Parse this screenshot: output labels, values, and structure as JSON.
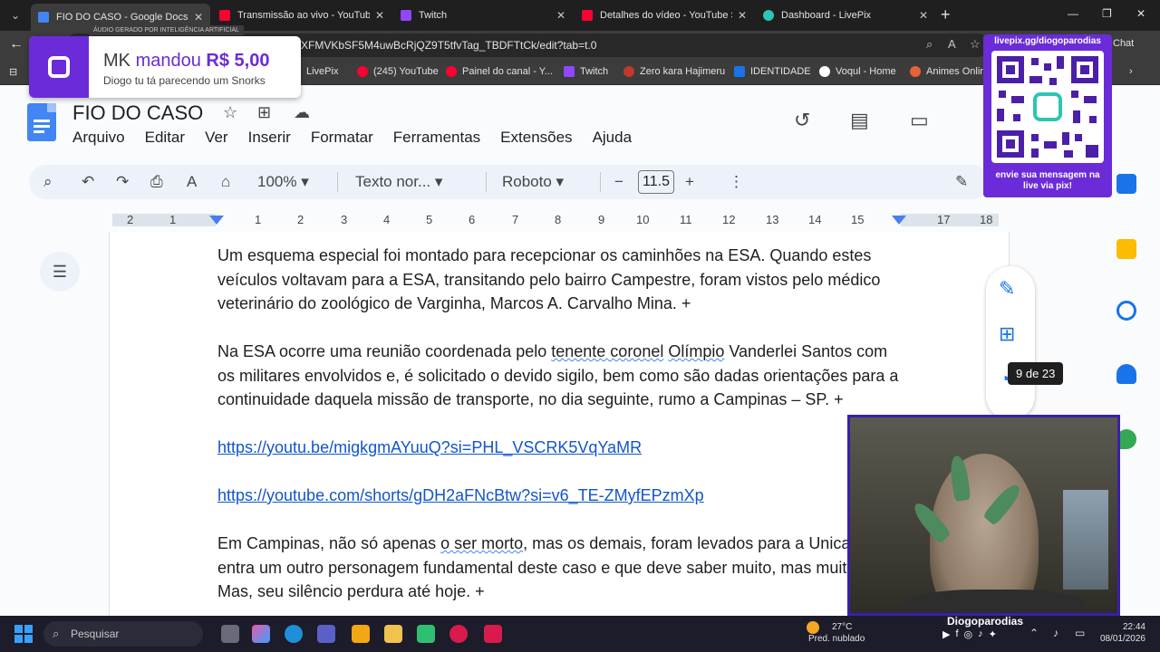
{
  "browser": {
    "tabs": [
      {
        "title": "FIO DO CASO - Google Docs",
        "active": true,
        "favicon_color": "#4285f4"
      },
      {
        "title": "Transmissão ao vivo - YouTube Studio",
        "active": false,
        "favicon_color": "#ff0033"
      },
      {
        "title": "Twitch",
        "active": false,
        "favicon_color": "#9146ff"
      },
      {
        "title": "Detalhes do vídeo - YouTube Studio",
        "active": false,
        "favicon_color": "#ff0033"
      },
      {
        "title": "Dashboard - LivePix",
        "active": false,
        "favicon_color": "#2ec4b6"
      }
    ],
    "url": "XFMVKbSF5M4uwBcRjQZ9T5tfvTag_TBDFTtCk/edit?tab=t.0",
    "chat_label": "Chat",
    "bookmarks": [
      {
        "label": "LivePix",
        "color": "#2ec4b6"
      },
      {
        "label": "(245) YouTube",
        "color": "#ff0033"
      },
      {
        "label": "Painel do canal - Y...",
        "color": "#ff0033"
      },
      {
        "label": "Twitch",
        "color": "#9146ff"
      },
      {
        "label": "Zero kara Hajimeru",
        "color": "#c0392b"
      },
      {
        "label": "IDENTIDADE",
        "color": "#1a73e8"
      },
      {
        "label": "Voqul - Home",
        "color": "#ffffff"
      },
      {
        "label": "Animes Online",
        "color": "#e8613a"
      }
    ]
  },
  "docs": {
    "title": "FIO DO CASO",
    "menus": [
      "Arquivo",
      "Editar",
      "Ver",
      "Inserir",
      "Formatar",
      "Ferramentas",
      "Extensões",
      "Ajuda"
    ],
    "toolbar": {
      "zoom": "100%",
      "style": "Texto nor...",
      "font": "Roboto",
      "font_size": "11.5"
    },
    "ruler_numbers": [
      "2",
      "1",
      "1",
      "2",
      "3",
      "4",
      "5",
      "6",
      "7",
      "8",
      "9",
      "10",
      "11",
      "12",
      "13",
      "14",
      "15",
      "16",
      "17",
      "18"
    ],
    "body": {
      "p1": "Um esquema especial foi montado para recepcionar os caminhões na ESA. Quando estes veículos voltavam para a ESA, transitando pelo bairro Campestre, foram vistos pelo médico veterinário do zoológico de Varginha, Marcos A. Carvalho Mina. +",
      "p2_a": "Na ESA ocorre uma reunião coordenada pelo ",
      "p2_b": "tenente coronel",
      "p2_c": " ",
      "p2_d": "Olímpio",
      "p2_e": " Vanderlei Santos com os militares envolvidos e, é solicitado o devido sigilo, bem como são dadas orientações para a continuidade daquela missão de transporte, no dia seguinte, rumo a Campinas – SP. +",
      "link1": "https://youtu.be/migkgmAYuuQ?si=PHL_VSCRK5VqYaMR",
      "link2": "https://youtube.com/shorts/gDH2aFNcBtw?si=v6_TE-ZMyfEPzmXp",
      "p3_a": "Em Campinas, não só apenas ",
      "p3_b": "o ser morto",
      "p3_c": ", mas os demais, foram levados para a Unicamp. Lá, entra um outro personagem fundamental deste caso e que deve saber muito, mas muito coisa. Mas, seu silêncio perdura até hoje. +"
    },
    "find_tooltip": "9 de 23"
  },
  "overlays": {
    "donation": {
      "top_badge": "ÁUDIO GERADO POR INTELIGÊNCIA ARTIFICIAL",
      "donor": "MK",
      "verb": "mandou",
      "amount": "R$ 5,00",
      "message": "Diogo tu tá parecendo um Snorks"
    },
    "qr": {
      "header": "livepix.gg/diogoparodias",
      "footer_line1": "envie sua mensagem na",
      "footer_line2": "live via pix!"
    },
    "streamer_name": "Diogoparodias"
  },
  "taskbar": {
    "search_placeholder": "Pesquisar",
    "weather_temp": "27°C",
    "weather_desc": "Pred. nublado",
    "time": "22:44",
    "date": "08/01/2026"
  }
}
